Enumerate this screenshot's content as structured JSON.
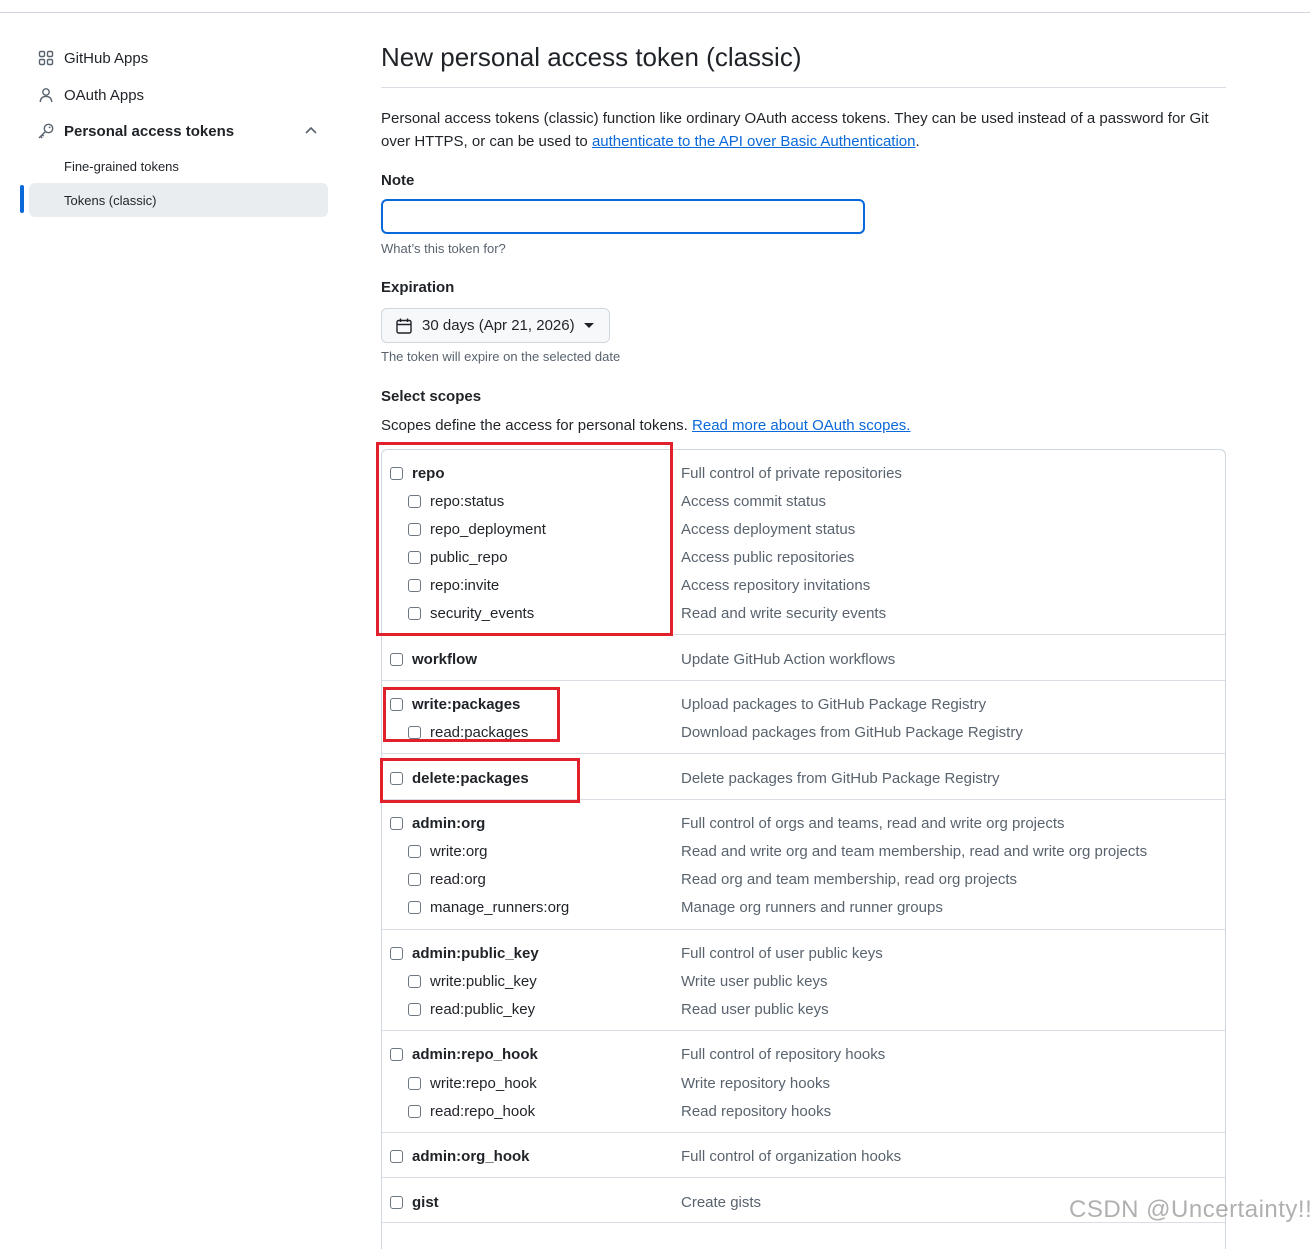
{
  "sidebar": {
    "items": [
      {
        "label": "GitHub Apps",
        "icon": "apps-icon"
      },
      {
        "label": "OAuth Apps",
        "icon": "person-icon"
      },
      {
        "label": "Personal access tokens",
        "icon": "key-icon"
      }
    ],
    "sub_items": [
      {
        "label": "Fine-grained tokens"
      },
      {
        "label": "Tokens (classic)",
        "active": true
      }
    ]
  },
  "main": {
    "title": "New personal access token (classic)",
    "intro_text": "Personal access tokens (classic) function like ordinary OAuth access tokens. They can be used instead of a password for Git over HTTPS, or can be used to ",
    "intro_link": "authenticate to the API over Basic Authentication",
    "intro_end": ".",
    "note_label": "Note",
    "note_value": "",
    "note_hint": "What’s this token for?",
    "expiration_label": "Expiration",
    "expiration_value": "30 days (Apr 21, 2026)",
    "expiration_hint": "The token will expire on the selected date",
    "scopes_label": "Select scopes",
    "scopes_desc": "Scopes define the access for personal tokens. ",
    "scopes_link": "Read more about OAuth scopes."
  },
  "scopes": [
    {
      "name": "repo",
      "desc": "Full control of private repositories"
    },
    {
      "name": "repo:status",
      "desc": "Access commit status"
    },
    {
      "name": "repo_deployment",
      "desc": "Access deployment status"
    },
    {
      "name": "public_repo",
      "desc": "Access public repositories"
    },
    {
      "name": "repo:invite",
      "desc": "Access repository invitations"
    },
    {
      "name": "security_events",
      "desc": "Read and write security events"
    },
    {
      "name": "workflow",
      "desc": "Update GitHub Action workflows"
    },
    {
      "name": "write:packages",
      "desc": "Upload packages to GitHub Package Registry"
    },
    {
      "name": "read:packages",
      "desc": "Download packages from GitHub Package Registry"
    },
    {
      "name": "delete:packages",
      "desc": "Delete packages from GitHub Package Registry"
    },
    {
      "name": "admin:org",
      "desc": "Full control of orgs and teams, read and write org projects"
    },
    {
      "name": "write:org",
      "desc": "Read and write org and team membership, read and write org projects"
    },
    {
      "name": "read:org",
      "desc": "Read org and team membership, read org projects"
    },
    {
      "name": "manage_runners:org",
      "desc": "Manage org runners and runner groups"
    },
    {
      "name": "admin:public_key",
      "desc": "Full control of user public keys"
    },
    {
      "name": "write:public_key",
      "desc": "Write user public keys"
    },
    {
      "name": "read:public_key",
      "desc": "Read user public keys"
    },
    {
      "name": "admin:repo_hook",
      "desc": "Full control of repository hooks"
    },
    {
      "name": "write:repo_hook",
      "desc": "Write repository hooks"
    },
    {
      "name": "read:repo_hook",
      "desc": "Read repository hooks"
    },
    {
      "name": "admin:org_hook",
      "desc": "Full control of organization hooks"
    },
    {
      "name": "gist",
      "desc": "Create gists"
    }
  ],
  "watermark": "CSDN @Uncertainty!!"
}
